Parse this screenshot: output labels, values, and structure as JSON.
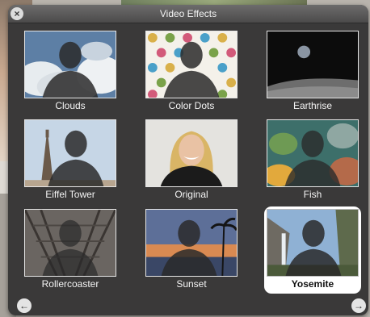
{
  "window": {
    "title": "Video Effects"
  },
  "buttons": {
    "close_icon": "×",
    "prev_icon": "←",
    "next_icon": "→"
  },
  "effects": [
    {
      "label": "Clouds",
      "selected": false
    },
    {
      "label": "Color Dots",
      "selected": false
    },
    {
      "label": "Earthrise",
      "selected": false
    },
    {
      "label": "Eiffel Tower",
      "selected": false
    },
    {
      "label": "Original",
      "selected": false
    },
    {
      "label": "Fish",
      "selected": false
    },
    {
      "label": "Rollercoaster",
      "selected": false
    },
    {
      "label": "Sunset",
      "selected": false
    },
    {
      "label": "Yosemite",
      "selected": true
    }
  ],
  "colors": {
    "panel_bg": "#3a3939",
    "selected_bg": "#ffffff",
    "label_text": "#f4f4f4"
  }
}
